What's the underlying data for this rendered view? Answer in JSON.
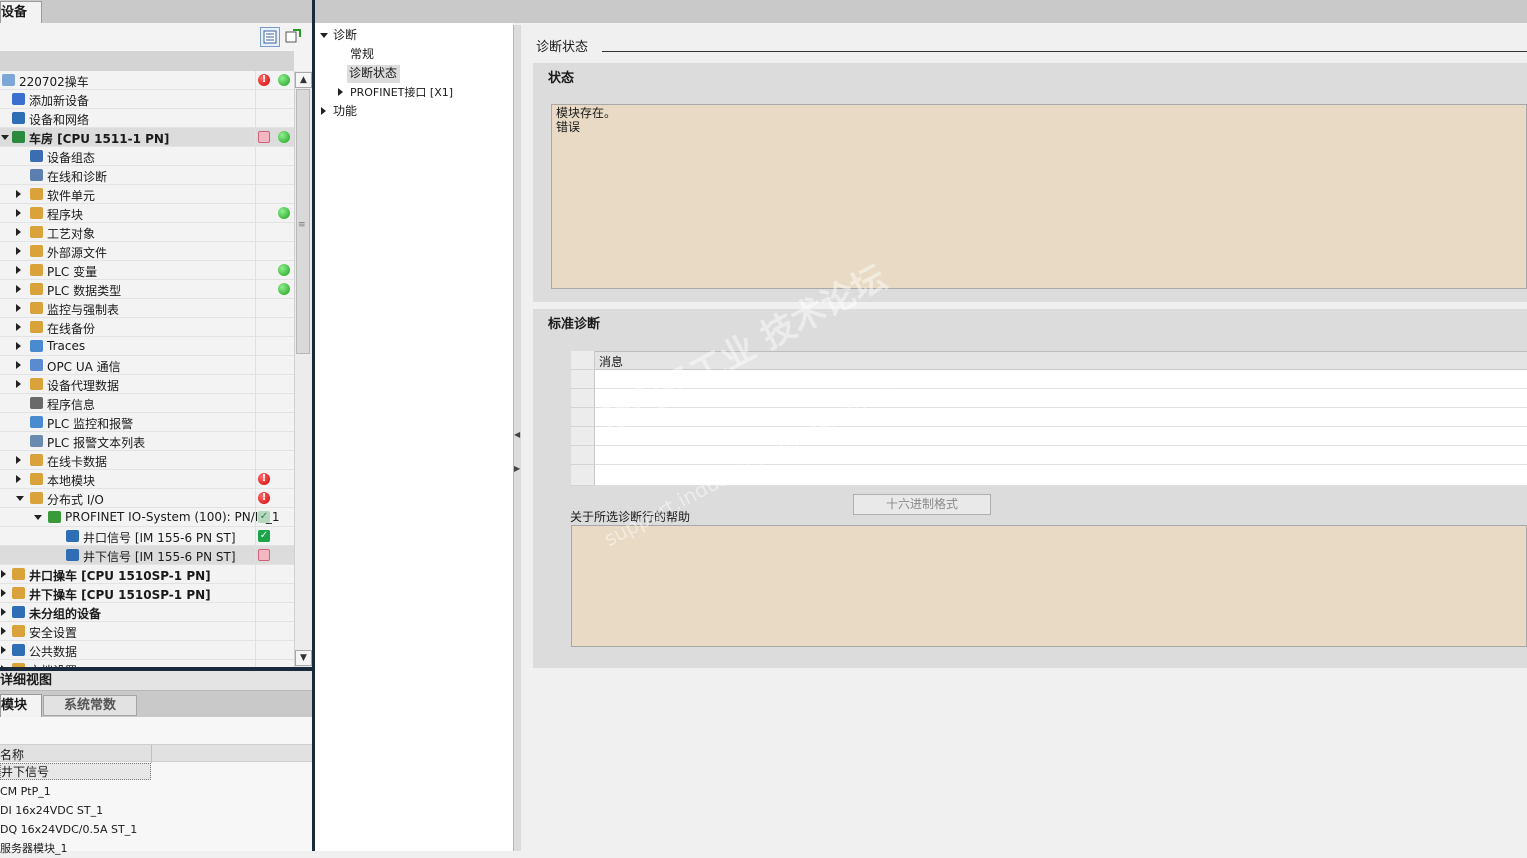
{
  "project_tree": {
    "panel_tab": "设备",
    "items": [
      {
        "label": "220702操车",
        "status": [
          "red-error",
          "green-ok"
        ]
      },
      {
        "label": "添加新设备",
        "status": []
      },
      {
        "label": "设备和网络",
        "status": []
      },
      {
        "label": "车房 [CPU 1511-1 PN]",
        "status": [
          "red-square",
          "green-ok"
        ]
      },
      {
        "label": "设备组态",
        "status": []
      },
      {
        "label": "在线和诊断",
        "status": []
      },
      {
        "label": "软件单元",
        "status": []
      },
      {
        "label": "程序块",
        "status": [
          "green-ok"
        ]
      },
      {
        "label": "工艺对象",
        "status": []
      },
      {
        "label": "外部源文件",
        "status": []
      },
      {
        "label": "PLC 变量",
        "status": [
          "green-ok"
        ]
      },
      {
        "label": "PLC 数据类型",
        "status": [
          "green-ok"
        ]
      },
      {
        "label": "监控与强制表",
        "status": []
      },
      {
        "label": "在线备份",
        "status": []
      },
      {
        "label": "Traces",
        "status": []
      },
      {
        "label": "OPC UA 通信",
        "status": []
      },
      {
        "label": "设备代理数据",
        "status": []
      },
      {
        "label": "程序信息",
        "status": []
      },
      {
        "label": "PLC 监控和报警",
        "status": []
      },
      {
        "label": "PLC 报警文本列表",
        "status": []
      },
      {
        "label": "在线卡数据",
        "status": []
      },
      {
        "label": "本地模块",
        "status": [
          "red-error"
        ]
      },
      {
        "label": "分布式 I/O",
        "status": [
          "red-error"
        ]
      },
      {
        "label": "PROFINET IO-System (100): PN/IE_1",
        "status": [
          "check-grey"
        ]
      },
      {
        "label": "井口信号 [IM 155-6 PN ST]",
        "status": [
          "check-green"
        ]
      },
      {
        "label": "井下信号 [IM 155-6 PN ST]",
        "status": [
          "red-square"
        ]
      },
      {
        "label": "井口操车 [CPU 1510SP-1 PN]",
        "status": []
      },
      {
        "label": "井下操车 [CPU 1510SP-1 PN]",
        "status": []
      },
      {
        "label": "未分组的设备",
        "status": []
      },
      {
        "label": "安全设置",
        "status": []
      },
      {
        "label": "公共数据",
        "status": []
      },
      {
        "label": "文档设置",
        "status": []
      }
    ]
  },
  "details": {
    "title": "详细视图",
    "tab_module": "模块",
    "tab_sysconst": "系统常数",
    "col_name": "名称",
    "rows": [
      "井下信号",
      "CM PtP_1",
      "DI 16x24VDC ST_1",
      "DQ 16x24VDC/0.5A ST_1",
      "服务器模块_1"
    ]
  },
  "nav": {
    "diag": "诊断",
    "general": "常规",
    "diag_status": "诊断状态",
    "profinet": "PROFINET接口 [X1]",
    "func": "功能"
  },
  "content": {
    "section_title": "诊断状态",
    "status_title": "状态",
    "status_text_line1": "模块存在。",
    "status_text_line2": "错误",
    "std_diag_title": "标准诊断",
    "msg_col": "消息",
    "hex_button": "十六进制格式",
    "help_label": "关于所选诊断行的帮助"
  },
  "watermark": {
    "line1": "西门子工业 技术论坛",
    "line2": "support.industry.siemens.com/cs"
  },
  "colors": {
    "status_box_bg": "#e8dac4",
    "panel_bg": "#dcdcdc",
    "ok_green": "#1ea01e",
    "error_red": "#d40000"
  }
}
